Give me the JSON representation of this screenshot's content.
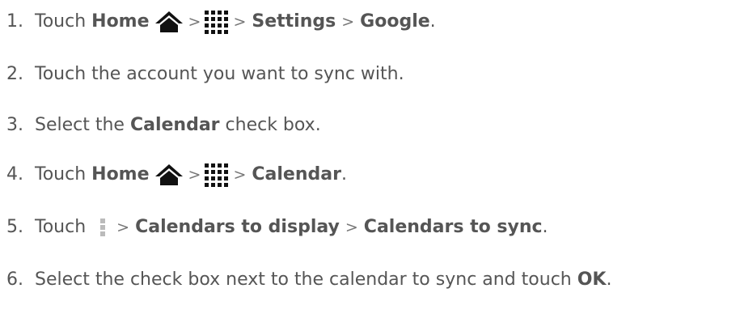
{
  "steps": [
    {
      "num": "1.",
      "touch": "Touch",
      "home": "Home",
      "gt1": ">",
      "gt2": ">",
      "settings": "Settings",
      "gt3": ">",
      "google": "Google",
      "end": "."
    },
    {
      "num": "2.",
      "text": "Touch the account you want to sync with."
    },
    {
      "num": "3.",
      "pre": "Select the",
      "bold": "Calendar",
      "post": "check box."
    },
    {
      "num": "4.",
      "touch": "Touch",
      "home": "Home",
      "gt1": ">",
      "gt2": ">",
      "calendar": "Calendar",
      "end": "."
    },
    {
      "num": "5.",
      "touch": "Touch",
      "gt1": ">",
      "display": "Calendars to display",
      "gt2": ">",
      "sync": "Calendars to sync",
      "end": "."
    },
    {
      "num": "6.",
      "text": "Select the check box next to the calendar to sync and touch",
      "ok": "OK",
      "end": "."
    }
  ],
  "icons": {
    "home": "home-icon",
    "apps": "apps-grid-icon",
    "menu": "menu-dots-icon"
  },
  "colors": {
    "text": "#555555",
    "icon": "#111111",
    "menu_icon": "#bbbbbb"
  }
}
